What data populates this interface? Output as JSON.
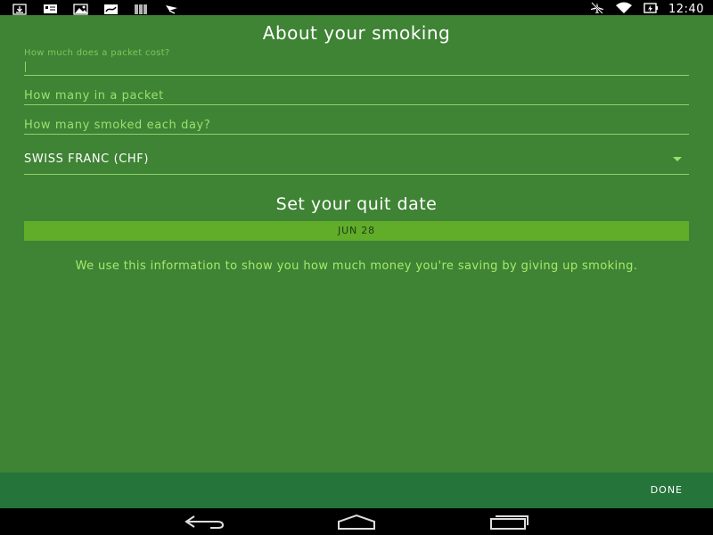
{
  "status_bar": {
    "time": "12:40",
    "left_icons": [
      "download-icon",
      "message-icon",
      "photo-icon",
      "map-icon",
      "barcode-icon",
      "play-store-icon"
    ],
    "right_icons": [
      "airplane-mode-icon",
      "wifi-icon",
      "battery-icon"
    ]
  },
  "form": {
    "title": "About your smoking",
    "packet_cost": {
      "label": "How much does a packet cost?",
      "value": ""
    },
    "packet_count": {
      "placeholder": "How many in a packet",
      "value": ""
    },
    "daily_count": {
      "placeholder": "How many smoked each day?",
      "value": ""
    },
    "currency": {
      "selected": "SWISS FRANC (CHF)"
    },
    "quit_title": "Set your quit date",
    "quit_date": "JUN 28",
    "info": "We use this information to show you how much money you're saving by giving up smoking."
  },
  "action_bar": {
    "done_label": "DONE"
  },
  "nav_bar": {
    "icons": [
      "back-icon",
      "home-icon",
      "recents-icon"
    ]
  },
  "colors": {
    "background": "#3f8335",
    "accent": "#61ad2a",
    "action_bar": "#25743a",
    "hint_text": "#9be06f"
  }
}
